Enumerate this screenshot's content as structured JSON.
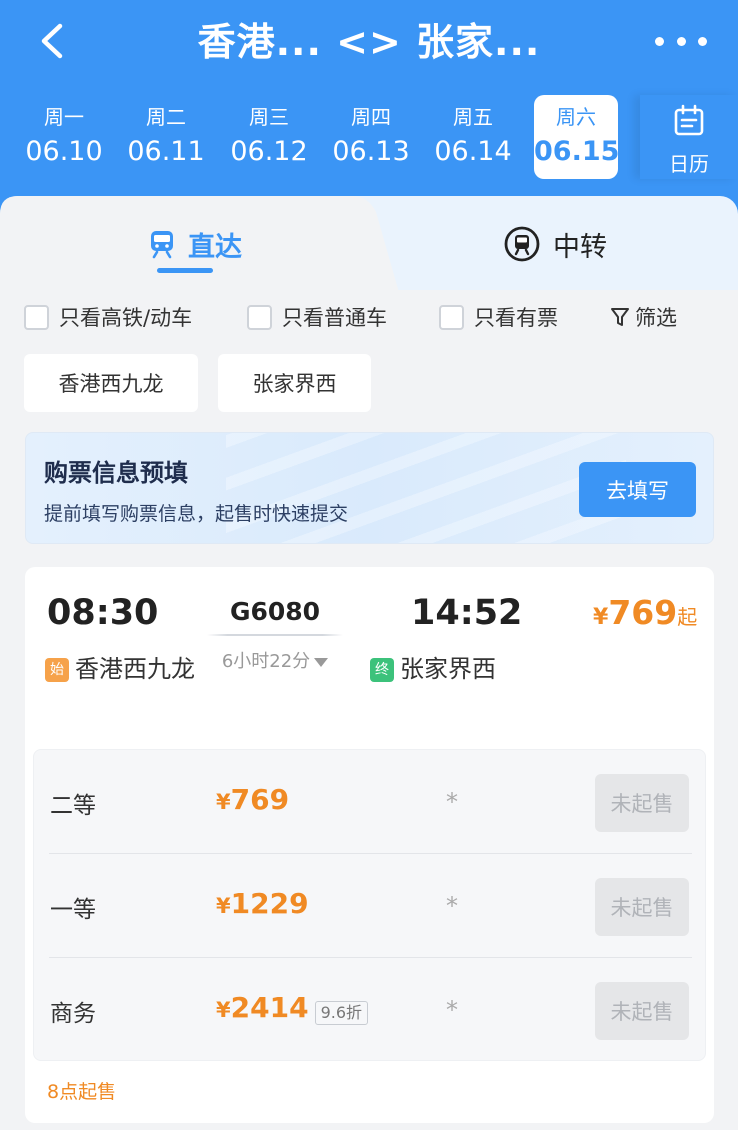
{
  "header": {
    "title": "香港... <> 张家...",
    "dates": [
      {
        "weekday": "周一",
        "date": "06.10",
        "active": false
      },
      {
        "weekday": "周二",
        "date": "06.11",
        "active": false
      },
      {
        "weekday": "周三",
        "date": "06.12",
        "active": false
      },
      {
        "weekday": "周四",
        "date": "06.13",
        "active": false
      },
      {
        "weekday": "周五",
        "date": "06.14",
        "active": false
      },
      {
        "weekday": "周六",
        "date": "06.15",
        "active": true
      }
    ],
    "calendar_label": "日历"
  },
  "tabs": {
    "direct": "直达",
    "transfer": "中转"
  },
  "filters": {
    "high_speed": "只看高铁/动车",
    "normal": "只看普通车",
    "available": "只看有票",
    "filter_label": "筛选",
    "stations": [
      "香港西九龙",
      "张家界西"
    ]
  },
  "banner": {
    "title": "购票信息预填",
    "subtitle": "提前填写购票信息，起售时快速提交",
    "button": "去填写"
  },
  "train": {
    "departure_time": "08:30",
    "arrival_time": "14:52",
    "number": "G6080",
    "duration": "6小时22分",
    "price_symbol": "¥",
    "price": "769",
    "price_suffix": "起",
    "start_badge": "始",
    "end_badge": "终",
    "departure_station": "香港西九龙",
    "arrival_station": "张家界西",
    "seats": [
      {
        "name": "二等",
        "price": "769",
        "discount": "",
        "availability": "*",
        "button": "未起售"
      },
      {
        "name": "一等",
        "price": "1229",
        "discount": "",
        "availability": "*",
        "button": "未起售"
      },
      {
        "name": "商务",
        "price": "2414",
        "discount": "9.6折",
        "availability": "*",
        "button": "未起售"
      }
    ],
    "sale_note": "8点起售"
  },
  "colors": {
    "brand": "#3b95f5",
    "price": "#f08a24",
    "start_badge": "#f6a24a",
    "end_badge": "#3cc27b"
  }
}
